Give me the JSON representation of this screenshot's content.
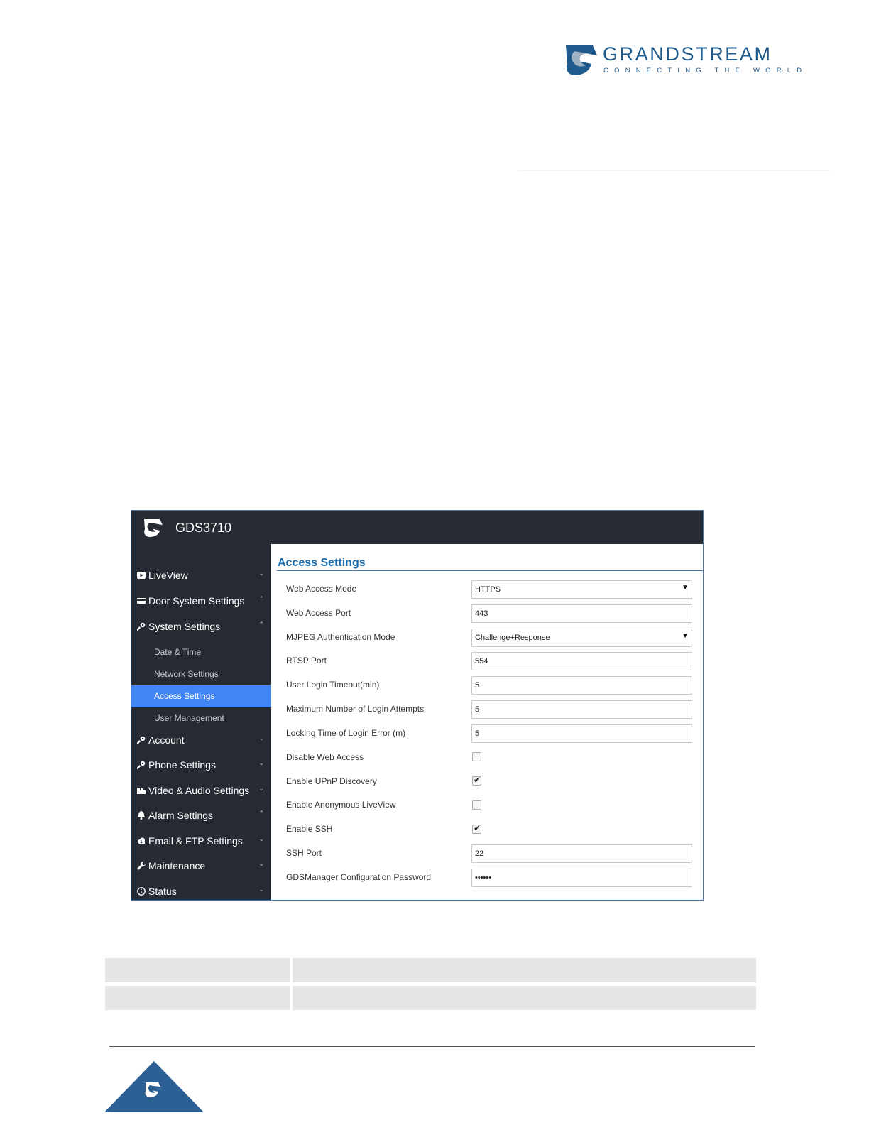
{
  "brand": {
    "name": "GRANDSTREAM",
    "tagline": "CONNECTING THE WORLD",
    "color": "#1f5a8c"
  },
  "app": {
    "title": "GDS3710",
    "accent": "#4285f4",
    "title_color": "#1a6aa8"
  },
  "sidebar": {
    "items": [
      {
        "label": "LiveView",
        "icon": "play-icon",
        "chevron": "⌄"
      },
      {
        "label": "Door System Settings",
        "icon": "card-icon",
        "chevron": "⌃"
      },
      {
        "label": "System Settings",
        "icon": "key-icon",
        "chevron": "⌃"
      },
      {
        "label": "Account",
        "icon": "key-icon",
        "chevron": "⌄"
      },
      {
        "label": "Phone Settings",
        "icon": "key-icon",
        "chevron": "⌄"
      },
      {
        "label": "Video & Audio Settings",
        "icon": "camera-icon",
        "chevron": "⌄"
      },
      {
        "label": "Alarm Settings",
        "icon": "bell-icon",
        "chevron": "⌃"
      },
      {
        "label": "Email & FTP Settings",
        "icon": "cloud-icon",
        "chevron": "⌄"
      },
      {
        "label": "Maintenance",
        "icon": "wrench-icon",
        "chevron": "⌄"
      },
      {
        "label": "Status",
        "icon": "info-icon",
        "chevron": "⌄"
      }
    ],
    "system_sub": [
      {
        "label": "Date & Time",
        "active": false
      },
      {
        "label": "Network Settings",
        "active": false
      },
      {
        "label": "Access Settings",
        "active": true
      },
      {
        "label": "User Management",
        "active": false
      }
    ]
  },
  "content": {
    "title": "Access Settings",
    "web_access_mode": {
      "label": "Web Access Mode",
      "value": "HTTPS"
    },
    "web_access_port": {
      "label": "Web Access Port",
      "value": "443"
    },
    "mjpeg_auth_mode": {
      "label": "MJPEG Authentication Mode",
      "value": "Challenge+Response"
    },
    "rtsp_port": {
      "label": "RTSP Port",
      "value": "554"
    },
    "user_login_timeout": {
      "label": "User Login Timeout(min)",
      "value": "5"
    },
    "max_login_attempts": {
      "label": "Maximum Number of Login Attempts",
      "value": "5"
    },
    "locking_time": {
      "label": "Locking Time of Login Error (m)",
      "value": "5"
    },
    "disable_web_access": {
      "label": "Disable Web Access",
      "checked": false
    },
    "enable_upnp": {
      "label": "Enable UPnP Discovery",
      "checked": true
    },
    "enable_anon_liveview": {
      "label": "Enable Anonymous LiveView",
      "checked": false
    },
    "enable_ssh": {
      "label": "Enable SSH",
      "checked": true
    },
    "ssh_port": {
      "label": "SSH Port",
      "value": "22"
    },
    "gdsmanager_password": {
      "label": "GDSManager Configuration Password",
      "value": "••••••"
    }
  },
  "arrow_glyph": "▼",
  "check_glyph": "✔"
}
